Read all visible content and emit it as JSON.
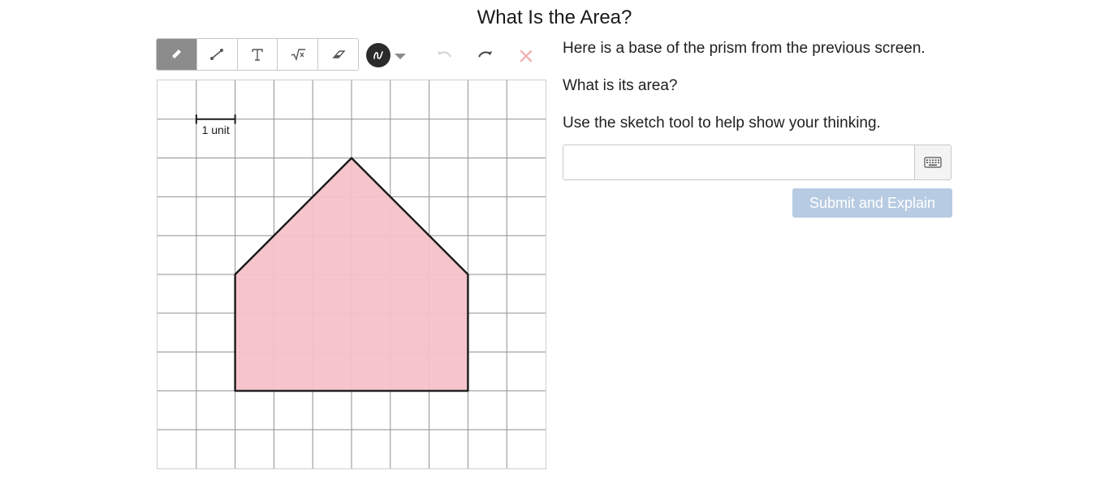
{
  "page": {
    "title": "What Is the Area?"
  },
  "toolbar": {
    "tools": [
      {
        "name": "pencil-icon",
        "active": true
      },
      {
        "name": "line-icon",
        "active": false
      },
      {
        "name": "text-icon",
        "active": false
      },
      {
        "name": "math-icon",
        "active": false
      },
      {
        "name": "eraser-icon",
        "active": false
      }
    ],
    "color": "#2b2b2b",
    "undo": "undo-icon",
    "redo": "redo-icon",
    "clear": "close-icon",
    "clear_color": "#f0b4b4"
  },
  "sketch": {
    "scale_label": "1 unit",
    "grid_cells": 10,
    "shape_fill": "#f4c2c8",
    "shape_stroke": "#1a1a1a"
  },
  "prompt": {
    "line1": "Here is a base of the prism from the previous screen.",
    "line2": "What is its area?",
    "line3": "Use the sketch tool to help show your thinking."
  },
  "answer": {
    "value": "",
    "keypad_icon": "keyboard-icon"
  },
  "submit": {
    "label": "Submit and Explain",
    "color": "#b7cbe2"
  }
}
